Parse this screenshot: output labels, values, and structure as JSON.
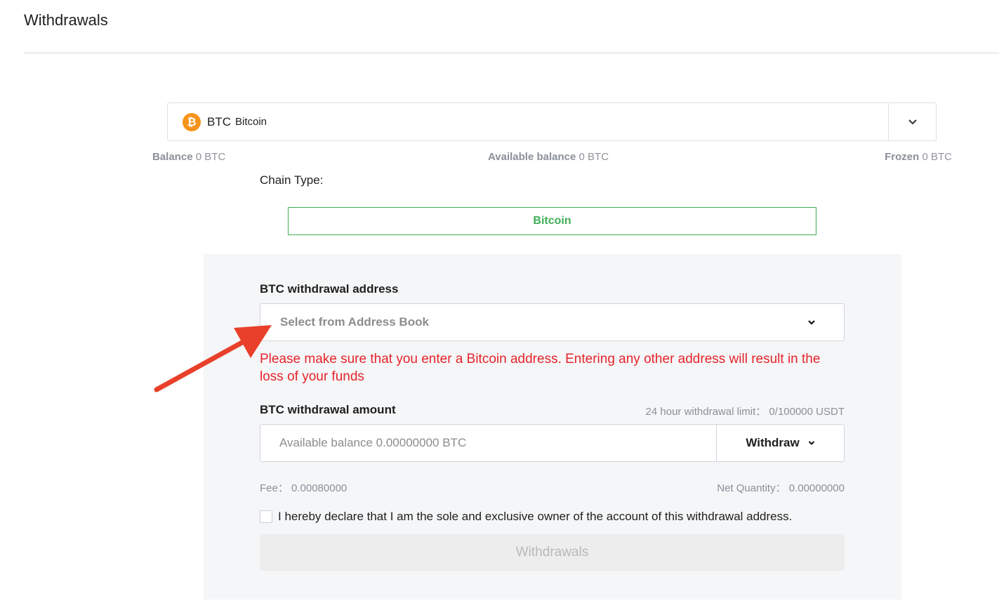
{
  "header": {
    "title": "Withdrawals"
  },
  "coin_selector": {
    "symbol": "BTC",
    "name": "Bitcoin",
    "icon": "bitcoin-icon",
    "caret_icon": "chevron-down-icon"
  },
  "balances": {
    "balance_label": "Balance",
    "balance_value": "0 BTC",
    "available_label": "Available balance",
    "available_value": "0 BTC",
    "frozen_label": "Frozen",
    "frozen_value": "0 BTC"
  },
  "chain": {
    "label": "Chain Type:",
    "selected": "Bitcoin"
  },
  "address": {
    "label": "BTC withdrawal address",
    "placeholder": "Select from Address Book",
    "warning": "Please make sure that you enter a Bitcoin address. Entering any other address will result in the loss of your funds"
  },
  "amount": {
    "label": "BTC withdrawal amount",
    "limit_text": "24 hour withdrawal limit：  0/100000 USDT",
    "placeholder": "Available balance 0.00000000 BTC",
    "type_label": "Withdraw"
  },
  "fees": {
    "fee_text": "Fee：  0.00080000",
    "net_text": "Net Quantity：  0.00000000"
  },
  "declaration": {
    "text": "I hereby declare that I am the sole and exclusive owner of the account of this withdrawal address.",
    "checked": false
  },
  "submit": {
    "label": "Withdrawals"
  },
  "colors": {
    "accent_green": "#3fae55",
    "warning_red": "#e5242b",
    "bitcoin_orange": "#f7931a",
    "arrow_red": "#e8402a"
  }
}
